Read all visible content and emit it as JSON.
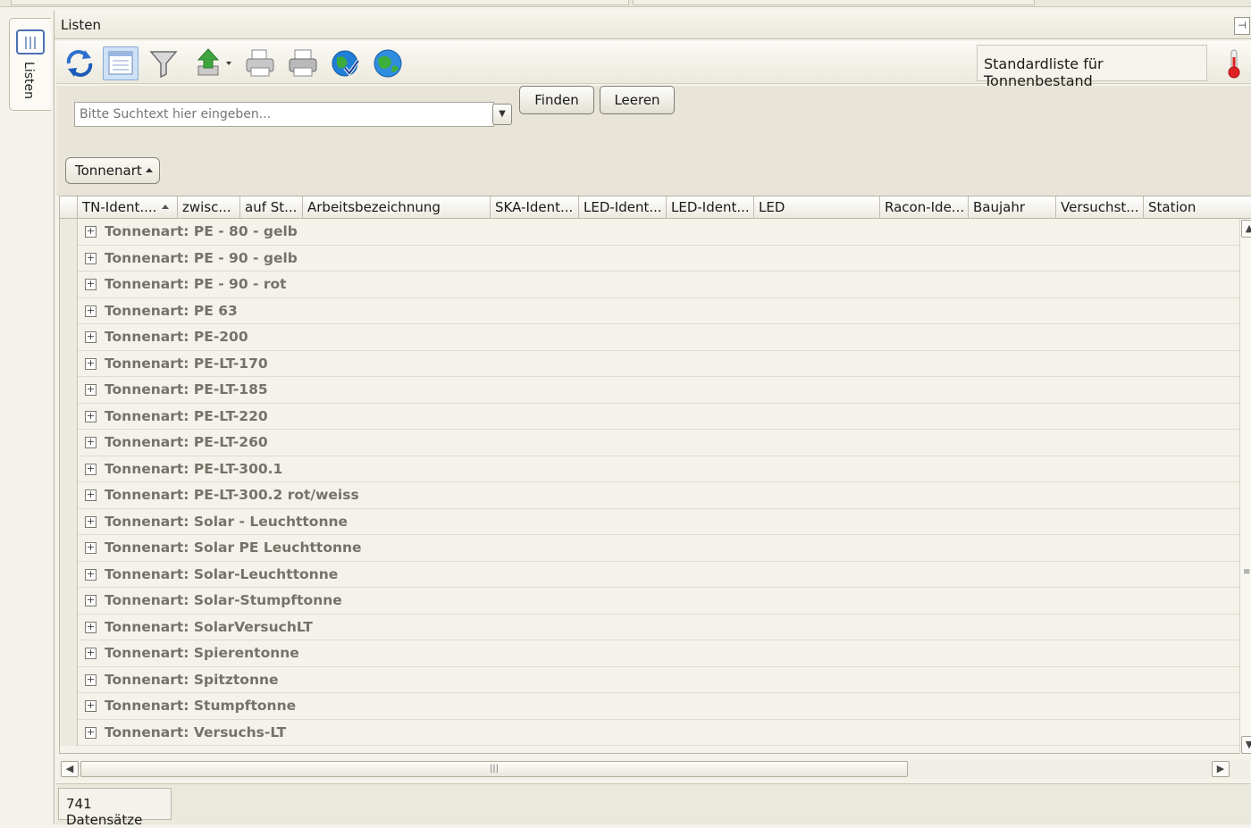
{
  "panel": {
    "title": "Listen",
    "side_tab_label": "Listen"
  },
  "toolbar": {
    "buttons": [
      "refresh-icon",
      "list-view-icon",
      "filter-icon",
      "export-icon",
      "print-preview-icon",
      "print-icon",
      "web-check-icon",
      "globe-icon"
    ],
    "standard_list_label": "Standardliste für Tonnenbestand"
  },
  "search": {
    "placeholder": "Bitte Suchtext hier eingeben...",
    "find_label": "Finden",
    "clear_label": "Leeren"
  },
  "grouping": {
    "chip_label": "Tonnenart"
  },
  "grid": {
    "columns": [
      "TN-Ident....",
      "zwisc...",
      "auf St...",
      "Arbeitsbezeichnung",
      "SKA-Ident...",
      "LED-Ident...",
      "LED-Ident...",
      "LED",
      "Racon-Ide...",
      "Baujahr",
      "Versuchst...",
      "Station"
    ],
    "sorted_column": "TN-Ident....",
    "group_rows": [
      "Tonnenart: PE - 80 - gelb",
      "Tonnenart: PE - 90 - gelb",
      "Tonnenart: PE - 90 - rot",
      "Tonnenart: PE 63",
      "Tonnenart: PE-200",
      "Tonnenart: PE-LT-170",
      "Tonnenart: PE-LT-185",
      "Tonnenart: PE-LT-220",
      "Tonnenart: PE-LT-260",
      "Tonnenart: PE-LT-300.1",
      "Tonnenart: PE-LT-300.2 rot/weiss",
      "Tonnenart: Solar - Leuchttonne",
      "Tonnenart: Solar PE Leuchttonne",
      "Tonnenart: Solar-Leuchttonne",
      "Tonnenart: Solar-Stumpftonne",
      "Tonnenart: SolarVersuchLT",
      "Tonnenart: Spierentonne",
      "Tonnenart: Spitztonne",
      "Tonnenart: Stumpftonne",
      "Tonnenart: Versuchs-LT"
    ]
  },
  "status": {
    "record_count": "741 Datensätze"
  },
  "colors": {
    "group_text": "#75726a",
    "accent": "#4a6fb5",
    "background": "#f4f2ea"
  }
}
